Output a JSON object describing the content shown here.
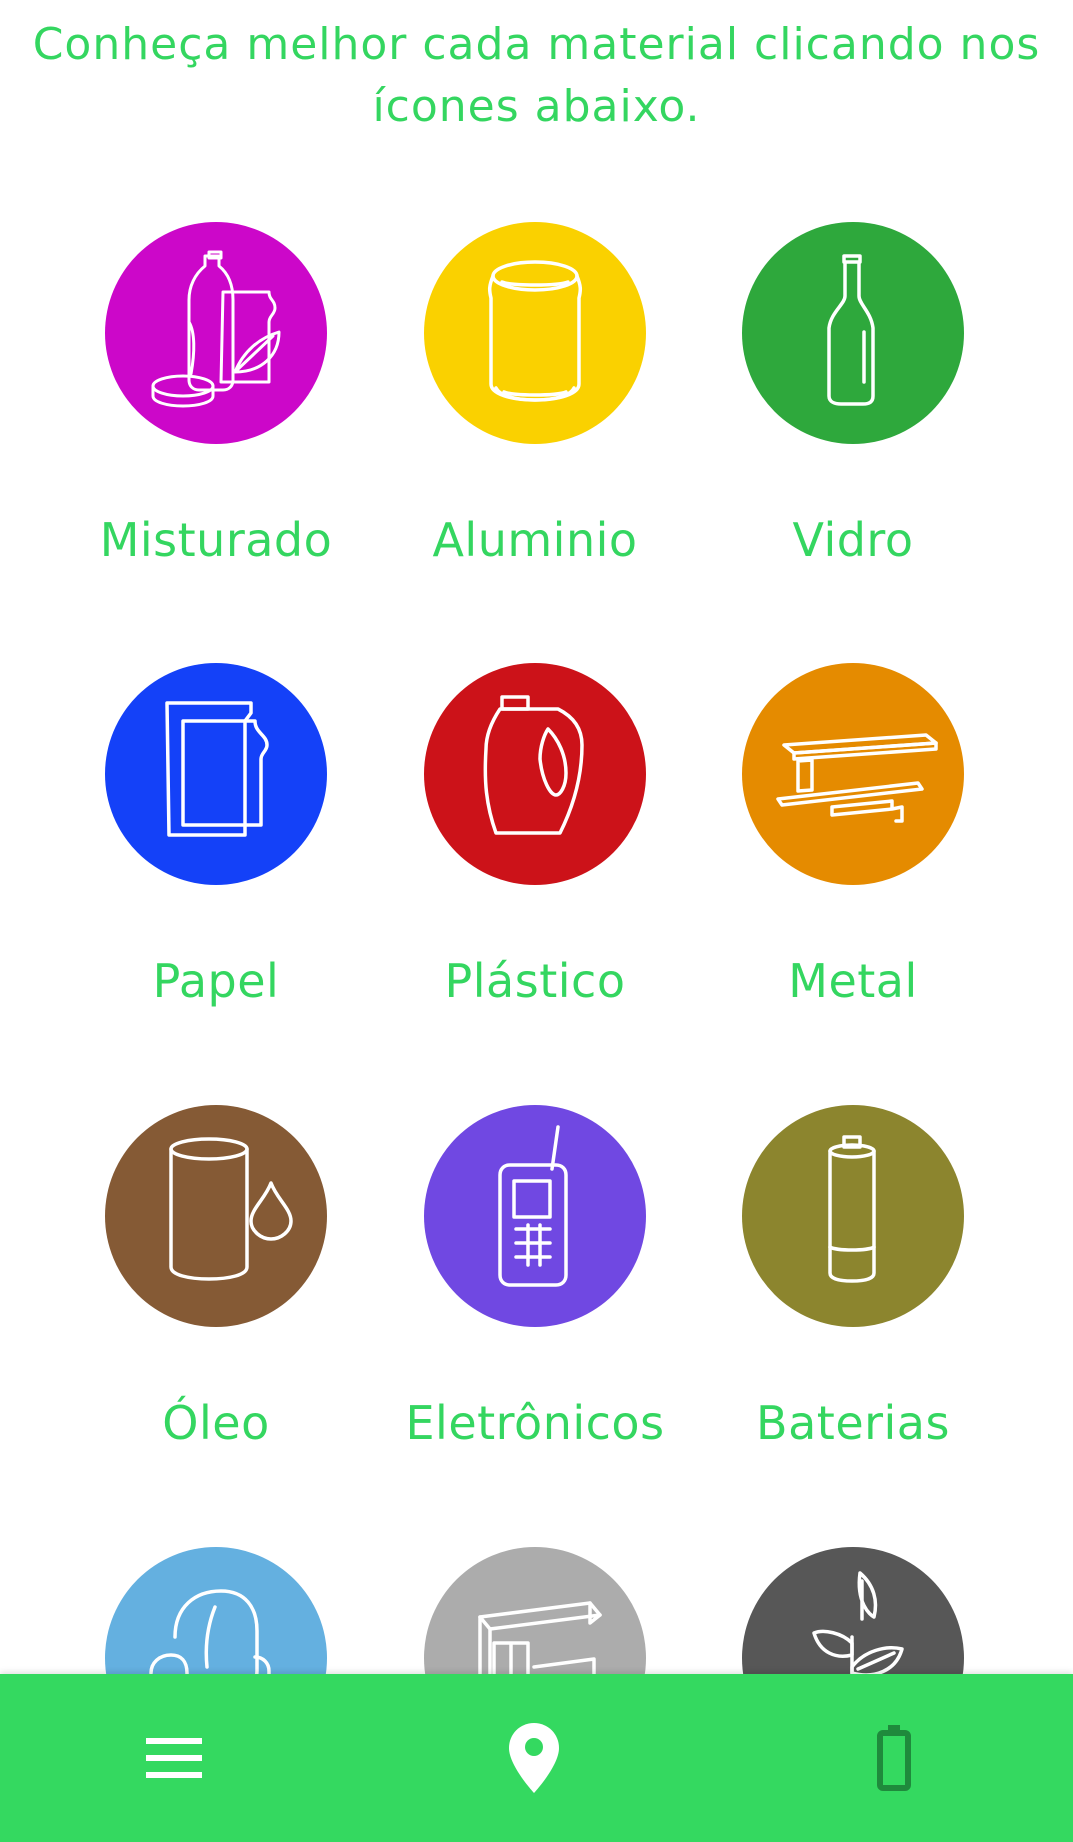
{
  "intro_text": "Conheça melhor cada material clicando nos ícones abaixo.",
  "materials": [
    {
      "label": "Misturado",
      "color": "#cc07c9",
      "icon": "mixed-waste-icon"
    },
    {
      "label": "Aluminio",
      "color": "#fad100",
      "icon": "can-icon"
    },
    {
      "label": "Vidro",
      "color": "#2ea83c",
      "icon": "bottle-icon"
    },
    {
      "label": "Papel",
      "color": "#1441f8",
      "icon": "paper-icon"
    },
    {
      "label": "Plástico",
      "color": "#cc1219",
      "icon": "plastic-jug-icon"
    },
    {
      "label": "Metal",
      "color": "#e58b00",
      "icon": "metal-beam-icon"
    },
    {
      "label": "Óleo",
      "color": "#855a35",
      "icon": "oil-icon"
    },
    {
      "label": "Eletrônicos",
      "color": "#7048e2",
      "icon": "phone-icon"
    },
    {
      "label": "Baterias",
      "color": "#8c852e",
      "icon": "battery-cell-icon"
    },
    {
      "label": "",
      "color": "#64b0e0",
      "icon": "armchair-icon"
    },
    {
      "label": "",
      "color": "#acacac",
      "icon": "furniture-icon"
    },
    {
      "label": "",
      "color": "#575757",
      "icon": "plant-icon"
    }
  ],
  "bottom_nav": {
    "background": "#34d960",
    "items": [
      "menu-icon",
      "map-pin-icon",
      "battery-icon"
    ]
  }
}
